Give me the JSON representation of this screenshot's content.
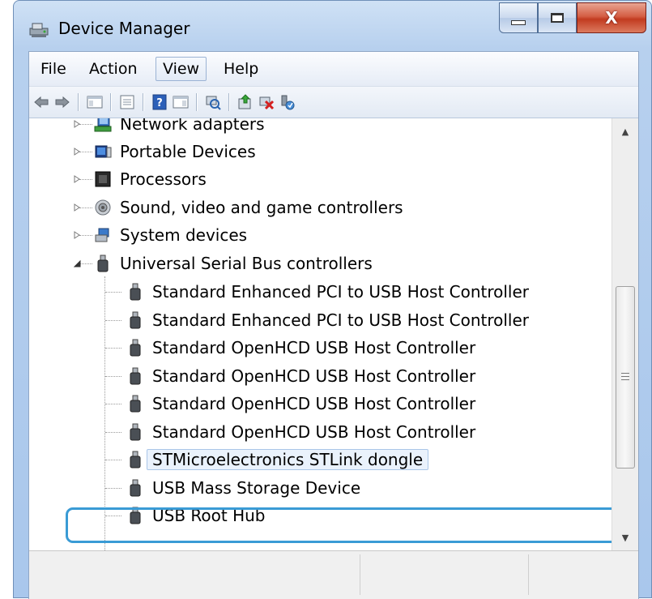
{
  "window": {
    "title": "Device Manager",
    "buttons": {
      "minimize": "minimize",
      "maximize": "maximize",
      "close": "X"
    }
  },
  "menu": [
    {
      "label": "File"
    },
    {
      "label": "Action"
    },
    {
      "label": "View"
    },
    {
      "label": "Help"
    }
  ],
  "toolbar": [
    "back-icon",
    "forward-icon",
    "show-hide-console-tree-icon",
    "properties-icon",
    "help-icon",
    "show-hide-action-pane-icon",
    "scan-hardware-icon",
    "update-driver-icon",
    "uninstall-icon",
    "enable-device-icon"
  ],
  "tree": {
    "categories": [
      {
        "label": "Network adapters",
        "icon": "network-adapter-icon"
      },
      {
        "label": "Portable Devices",
        "icon": "portable-device-icon"
      },
      {
        "label": "Processors",
        "icon": "processor-icon"
      },
      {
        "label": "Sound, video and game controllers",
        "icon": "speaker-icon"
      },
      {
        "label": "System devices",
        "icon": "system-devices-icon"
      },
      {
        "label": "Universal Serial Bus controllers",
        "icon": "usb-plug-icon"
      }
    ],
    "usb_devices": [
      "Standard Enhanced PCI to USB Host Controller",
      "Standard Enhanced PCI to USB Host Controller",
      "Standard OpenHCD USB Host Controller",
      "Standard OpenHCD USB Host Controller",
      "Standard OpenHCD USB Host Controller",
      "Standard OpenHCD USB Host Controller",
      "STMicroelectronics STLink dongle",
      "USB Mass Storage Device",
      "USB Root Hub"
    ],
    "selected_device": "STMicroelectronics STLink dongle"
  },
  "scrollbar": {
    "position_fraction": 0.55,
    "grip_icon": "grip-lines-icon"
  },
  "colors": {
    "highlight": "#3a9bd5",
    "selection": "#eaf2fc"
  }
}
